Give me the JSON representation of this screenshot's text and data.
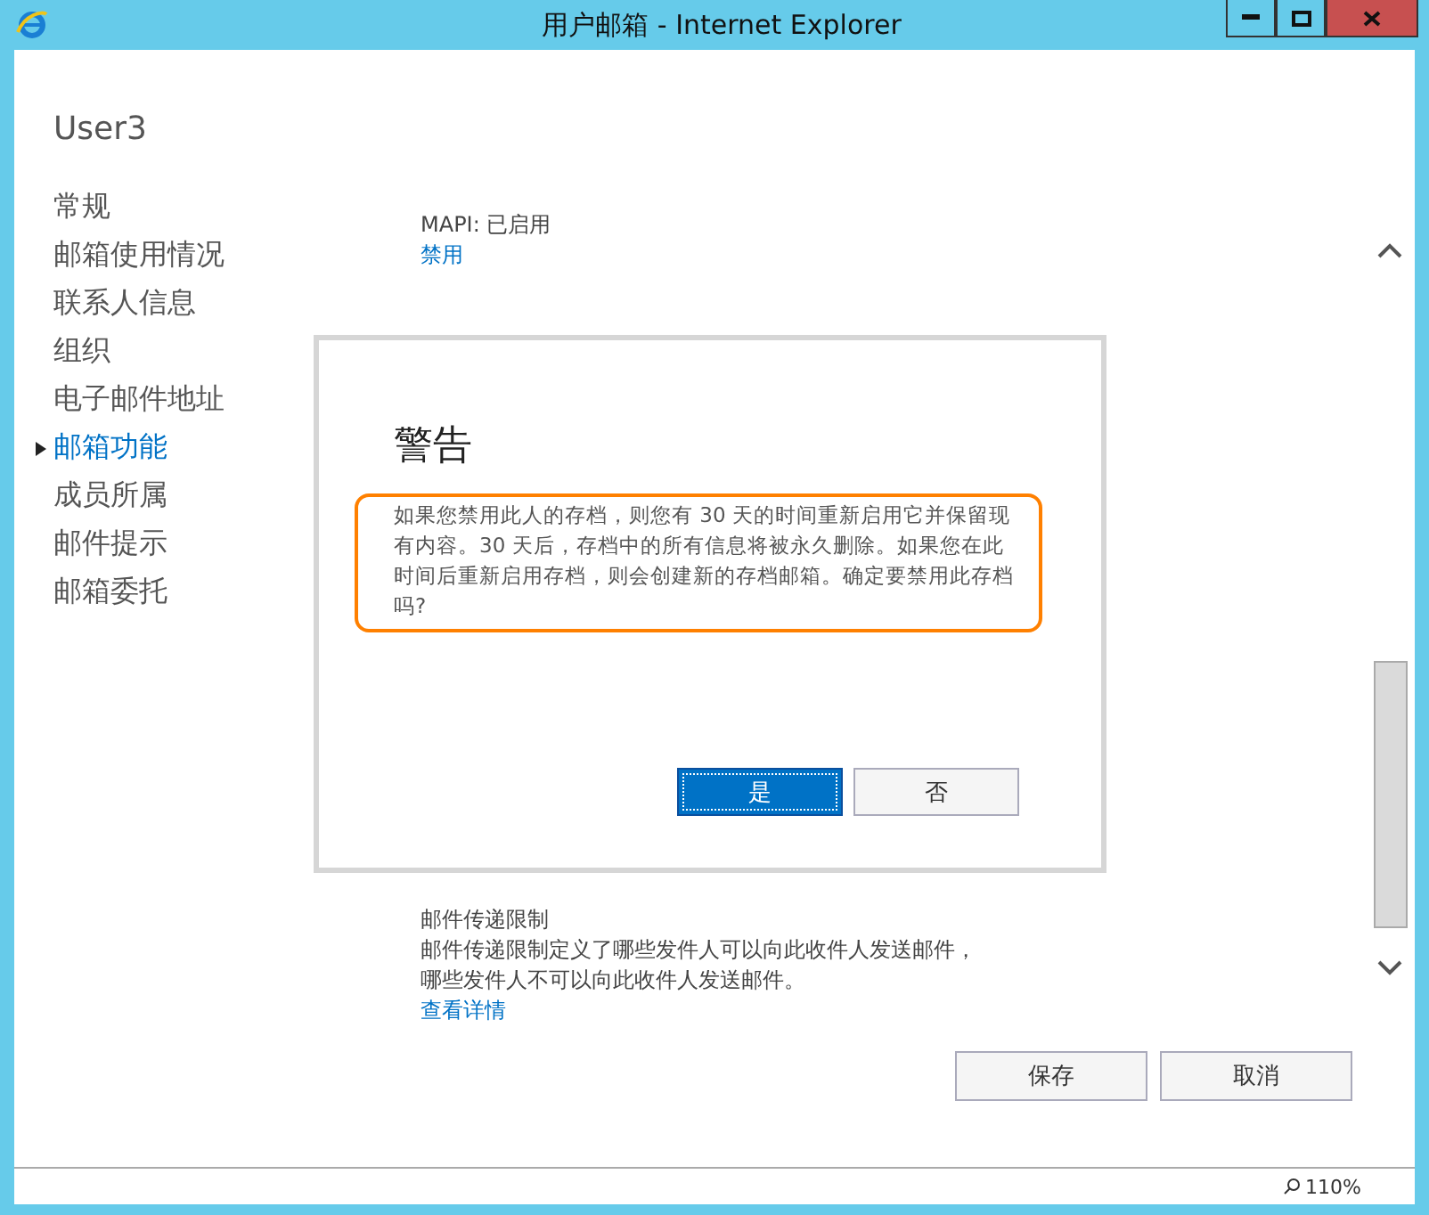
{
  "window": {
    "title": "用户邮箱 - Internet Explorer"
  },
  "user": "User3",
  "nav": [
    {
      "label": "常规",
      "selected": false
    },
    {
      "label": "邮箱使用情况",
      "selected": false
    },
    {
      "label": "联系人信息",
      "selected": false
    },
    {
      "label": "组织",
      "selected": false
    },
    {
      "label": "电子邮件地址",
      "selected": false
    },
    {
      "label": "邮箱功能",
      "selected": true
    },
    {
      "label": "成员所属",
      "selected": false
    },
    {
      "label": "邮件提示",
      "selected": false
    },
    {
      "label": "邮箱委托",
      "selected": false
    }
  ],
  "sections_top": [
    {
      "status": "MAPI: 已启用",
      "link": "禁用"
    }
  ],
  "section_bottom": {
    "title": "邮件传递限制",
    "description": "邮件传递限制定义了哪些发件人可以向此收件人发送邮件，哪些发件人不可以向此收件人发送邮件。",
    "link": "查看详情"
  },
  "dialog": {
    "title": "警告",
    "message": "如果您禁用此人的存档，则您有 30 天的时间重新启用它并保留现有内容。30 天后，存档中的所有信息将被永久删除。如果您在此时间后重新启用存档，则会创建新的存档邮箱。确定要禁用此存档吗?",
    "buttons": [
      {
        "label": "是",
        "selected": true
      },
      {
        "label": "否",
        "selected": false
      }
    ]
  },
  "buttons": [
    "保存",
    "取消"
  ],
  "status_bar": {
    "zoom": "110%"
  }
}
